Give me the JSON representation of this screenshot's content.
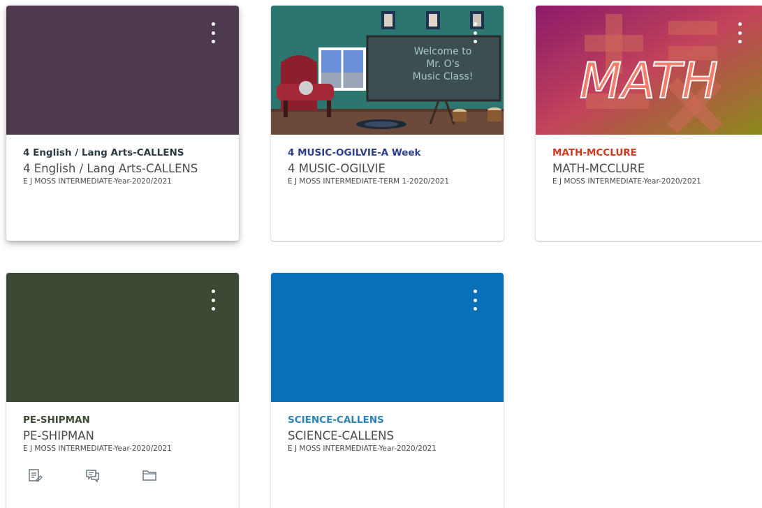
{
  "dashboard": {
    "cards": [
      {
        "link": "4 English / Lang Arts-CALLENS",
        "code": "4 English / Lang Arts-CALLENS",
        "term": "E J MOSS INTERMEDIATE-Year-2020/2021",
        "color": "#4e3a4f",
        "link_color": "#2d3b45",
        "options_icon": "kebab-icon"
      },
      {
        "link": "4 MUSIC-OGILVIE-A Week",
        "code": "4 MUSIC-OGILVIE",
        "term": "E J MOSS INTERMEDIATE-TERM 1-2020/2021",
        "color": "#2c6e6a",
        "link_color": "#2d3e8c",
        "board_text": [
          "Welcome to",
          "Mr. O's",
          "Music Class!"
        ],
        "options_icon": "kebab-icon"
      },
      {
        "link": "MATH-MCCLURE",
        "code": "MATH-MCCLURE",
        "term": "E J MOSS INTERMEDIATE-Year-2020/2021",
        "color": "#b03a55",
        "link_color": "#d23a1e",
        "header_text": "MATH",
        "options_icon": "kebab-icon"
      },
      {
        "link": "PE-SHIPMAN",
        "code": "PE-SHIPMAN",
        "term": "E J MOSS INTERMEDIATE-Year-2020/2021",
        "color": "#3c4a35",
        "link_color": "#3c4a35",
        "options_icon": "kebab-icon",
        "actions": [
          {
            "icon": "assignments-icon"
          },
          {
            "icon": "discussions-icon"
          },
          {
            "icon": "files-icon"
          }
        ]
      },
      {
        "link": "SCIENCE-CALLENS",
        "code": "SCIENCE-CALLENS",
        "term": "E J MOSS INTERMEDIATE-Year-2020/2021",
        "color": "#0770b8",
        "link_color": "#2c82b8",
        "options_icon": "kebab-icon"
      }
    ]
  }
}
